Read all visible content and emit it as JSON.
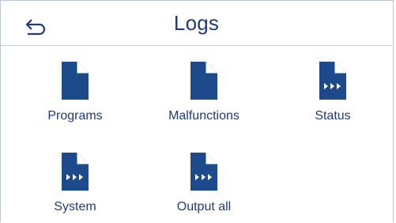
{
  "header": {
    "title": "Logs",
    "back_icon": "back-arrow-icon"
  },
  "tiles": [
    {
      "label": "Programs",
      "icon": "document-icon"
    },
    {
      "label": "Malfunctions",
      "icon": "document-icon"
    },
    {
      "label": "Status",
      "icon": "document-export-icon"
    },
    {
      "label": "System",
      "icon": "document-export-icon"
    },
    {
      "label": "Output all",
      "icon": "document-export-icon"
    }
  ],
  "colors": {
    "accent": "#1e3c78",
    "icon_fill": "#1d4a8a",
    "divider": "#c8cdd4"
  }
}
